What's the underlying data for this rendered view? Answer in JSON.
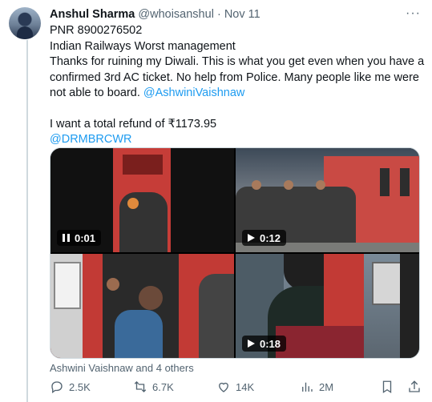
{
  "tweet": {
    "author_name": "Anshul Sharma",
    "handle": "@whoisanshul",
    "separator": "·",
    "date": "Nov 11",
    "more_icon": "more-icon",
    "lines": [
      "PNR 8900276502",
      "Indian Railways Worst management",
      "Thanks for ruining my Diwali. This is what you get even when you have a confirmed 3rd AC ticket. No help from Police. Many people like me were not able to board."
    ],
    "mention": "@AshwiniVaishnaw",
    "refund_line": "I want a total refund of ₹1173.95",
    "mention2": "@DRMBRCWR"
  },
  "media": [
    {
      "control": "pause-icon",
      "duration": "0:01"
    },
    {
      "control": "play-icon",
      "duration": "0:12"
    },
    {
      "control": "none",
      "duration": ""
    },
    {
      "control": "play-icon",
      "duration": "0:18"
    }
  ],
  "tagged": "Ashwini Vaishnaw and 4 others",
  "actions": {
    "replies": "2.5K",
    "retweets": "6.7K",
    "likes": "14K",
    "views": "2M"
  },
  "colors": {
    "link": "#1d9bf0",
    "muted": "#536471",
    "text": "#0f1419"
  }
}
